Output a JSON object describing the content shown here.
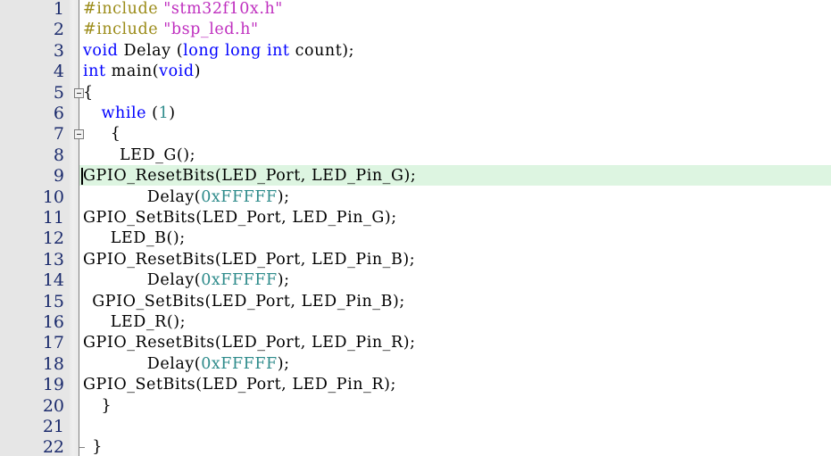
{
  "editor": {
    "name": "code-editor",
    "language": "C",
    "background_color": "#ffffff",
    "gutter_color": "#e6e6e6",
    "line_number_color": "#1a2a6c",
    "current_line_highlight_color": "#ddf5e1",
    "total_lines": 22,
    "cursor": {
      "line": 9,
      "column": 1
    }
  },
  "syntax_colors": {
    "preprocessor": "#9b8b18",
    "string": "#bf2fbf",
    "keyword": "#0000ff",
    "number": "#2e8b8b",
    "identifier": "#000000"
  },
  "lines": [
    {
      "number": "1",
      "indent": 0,
      "highlight": false,
      "fold": "none",
      "tokens": [
        {
          "t": "#include",
          "c": "tok-pre"
        },
        {
          "t": " ",
          "c": "tok-punct"
        },
        {
          "t": "\"stm32f10x.h\"",
          "c": "tok-str"
        }
      ]
    },
    {
      "number": "2",
      "indent": 0,
      "highlight": false,
      "fold": "none",
      "tokens": [
        {
          "t": "#include",
          "c": "tok-pre"
        },
        {
          "t": " ",
          "c": "tok-punct"
        },
        {
          "t": "\"bsp_led.h\"",
          "c": "tok-str"
        }
      ]
    },
    {
      "number": "3",
      "indent": 0,
      "highlight": false,
      "fold": "none",
      "tokens": [
        {
          "t": "void",
          "c": "tok-kw"
        },
        {
          "t": " Delay (",
          "c": "tok-id"
        },
        {
          "t": "long",
          "c": "tok-kw"
        },
        {
          "t": " ",
          "c": "tok-id"
        },
        {
          "t": "long",
          "c": "tok-kw"
        },
        {
          "t": " ",
          "c": "tok-id"
        },
        {
          "t": "int",
          "c": "tok-kw"
        },
        {
          "t": " count);",
          "c": "tok-id"
        }
      ]
    },
    {
      "number": "4",
      "indent": 0,
      "highlight": false,
      "fold": "none",
      "tokens": [
        {
          "t": "int",
          "c": "tok-kw"
        },
        {
          "t": " main(",
          "c": "tok-id"
        },
        {
          "t": "void",
          "c": "tok-kw"
        },
        {
          "t": ")",
          "c": "tok-id"
        }
      ]
    },
    {
      "number": "5",
      "indent": 0,
      "highlight": false,
      "fold": "open",
      "tokens": [
        {
          "t": "{",
          "c": "tok-punct"
        }
      ]
    },
    {
      "number": "6",
      "indent": 2,
      "highlight": false,
      "fold": "none",
      "tokens": [
        {
          "t": "while",
          "c": "tok-kw"
        },
        {
          "t": " (",
          "c": "tok-punct"
        },
        {
          "t": "1",
          "c": "tok-num"
        },
        {
          "t": ")",
          "c": "tok-punct"
        }
      ]
    },
    {
      "number": "7",
      "indent": 3,
      "highlight": false,
      "fold": "open",
      "tokens": [
        {
          "t": "{",
          "c": "tok-punct"
        }
      ]
    },
    {
      "number": "8",
      "indent": 4,
      "highlight": false,
      "fold": "none",
      "tokens": [
        {
          "t": "LED_G();",
          "c": "tok-id"
        }
      ]
    },
    {
      "number": "9",
      "indent": 0,
      "highlight": true,
      "fold": "none",
      "caret": true,
      "tokens": [
        {
          "t": "GPIO_ResetBits(LED_Port, LED_Pin_G);",
          "c": "tok-id"
        }
      ]
    },
    {
      "number": "10",
      "indent": 7,
      "highlight": false,
      "fold": "none",
      "tokens": [
        {
          "t": "Delay(",
          "c": "tok-id"
        },
        {
          "t": "0xFFFFF",
          "c": "tok-num"
        },
        {
          "t": ");",
          "c": "tok-id"
        }
      ]
    },
    {
      "number": "11",
      "indent": 0,
      "highlight": false,
      "fold": "none",
      "tokens": [
        {
          "t": "GPIO_SetBits(LED_Port, LED_Pin_G);",
          "c": "tok-id"
        }
      ]
    },
    {
      "number": "12",
      "indent": 3,
      "highlight": false,
      "fold": "none",
      "tokens": [
        {
          "t": "LED_B();",
          "c": "tok-id"
        }
      ]
    },
    {
      "number": "13",
      "indent": 0,
      "highlight": false,
      "fold": "none",
      "tokens": [
        {
          "t": "GPIO_ResetBits(LED_Port, LED_Pin_B);",
          "c": "tok-id"
        }
      ]
    },
    {
      "number": "14",
      "indent": 7,
      "highlight": false,
      "fold": "none",
      "tokens": [
        {
          "t": "Delay(",
          "c": "tok-id"
        },
        {
          "t": "0xFFFFF",
          "c": "tok-num"
        },
        {
          "t": ");",
          "c": "tok-id"
        }
      ]
    },
    {
      "number": "15",
      "indent": 1,
      "highlight": false,
      "fold": "none",
      "tokens": [
        {
          "t": "GPIO_SetBits(LED_Port, LED_Pin_B);",
          "c": "tok-id"
        }
      ]
    },
    {
      "number": "16",
      "indent": 3,
      "highlight": false,
      "fold": "none",
      "tokens": [
        {
          "t": "LED_R();",
          "c": "tok-id"
        }
      ]
    },
    {
      "number": "17",
      "indent": 0,
      "highlight": false,
      "fold": "none",
      "tokens": [
        {
          "t": "GPIO_ResetBits(LED_Port, LED_Pin_R);",
          "c": "tok-id"
        }
      ]
    },
    {
      "number": "18",
      "indent": 7,
      "highlight": false,
      "fold": "none",
      "tokens": [
        {
          "t": "Delay(",
          "c": "tok-id"
        },
        {
          "t": "0xFFFFF",
          "c": "tok-num"
        },
        {
          "t": ");",
          "c": "tok-id"
        }
      ]
    },
    {
      "number": "19",
      "indent": 0,
      "highlight": false,
      "fold": "none",
      "tokens": [
        {
          "t": "GPIO_SetBits(LED_Port, LED_Pin_R);",
          "c": "tok-id"
        }
      ]
    },
    {
      "number": "20",
      "indent": 2,
      "highlight": false,
      "fold": "none",
      "tokens": [
        {
          "t": "}",
          "c": "tok-punct"
        }
      ]
    },
    {
      "number": "21",
      "indent": 0,
      "highlight": false,
      "fold": "none",
      "tokens": []
    },
    {
      "number": "22",
      "indent": 1,
      "highlight": false,
      "fold": "end",
      "tokens": [
        {
          "t": "}",
          "c": "tok-punct"
        }
      ]
    }
  ]
}
